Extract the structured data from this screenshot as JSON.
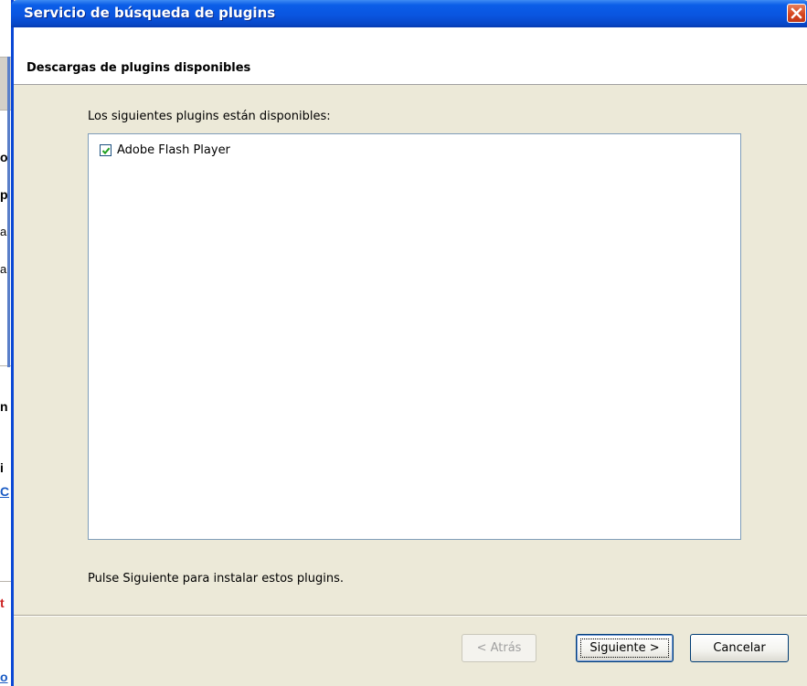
{
  "dialog": {
    "title": "Servicio de búsqueda de plugins",
    "header_title": "Descargas de plugins disponibles",
    "list_caption": "Los siguientes plugins están disponibles:",
    "plugins": [
      {
        "name": "Adobe Flash Player",
        "checked": true
      }
    ],
    "footer_text": "Pulse Siguiente para instalar estos plugins.",
    "buttons": {
      "back_label": "< Atrás",
      "next_label": "Siguiente >",
      "cancel_label": "Cancelar"
    }
  },
  "background_page": {
    "fragments": [
      "o",
      "p",
      "a",
      "a",
      "n",
      "i",
      "C",
      "t",
      "o"
    ]
  },
  "colors": {
    "titlebar": "#0a55e0",
    "dialog_bg": "#ece9d8",
    "close_button": "#d5431c",
    "checkbox_check": "#21a121"
  }
}
